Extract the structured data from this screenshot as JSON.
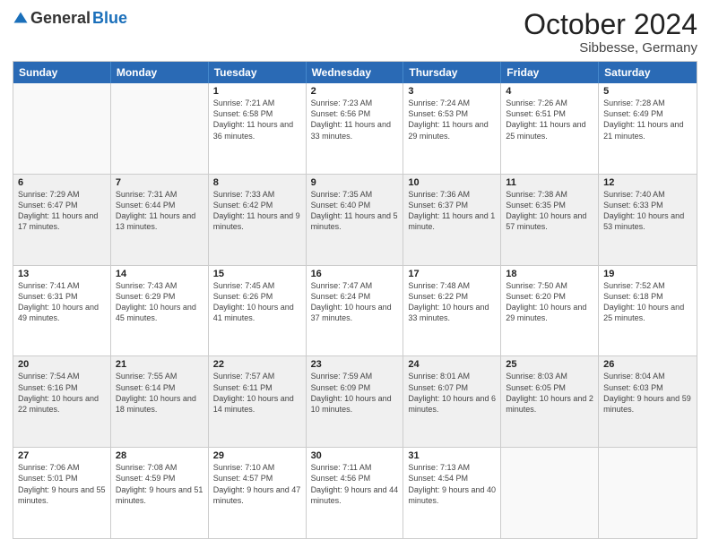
{
  "logo": {
    "general": "General",
    "blue": "Blue"
  },
  "title": "October 2024",
  "location": "Sibbesse, Germany",
  "days": [
    "Sunday",
    "Monday",
    "Tuesday",
    "Wednesday",
    "Thursday",
    "Friday",
    "Saturday"
  ],
  "weeks": [
    [
      {
        "day": "",
        "info": "",
        "empty": true
      },
      {
        "day": "",
        "info": "",
        "empty": true
      },
      {
        "day": "1",
        "info": "Sunrise: 7:21 AM\nSunset: 6:58 PM\nDaylight: 11 hours and 36 minutes."
      },
      {
        "day": "2",
        "info": "Sunrise: 7:23 AM\nSunset: 6:56 PM\nDaylight: 11 hours and 33 minutes."
      },
      {
        "day": "3",
        "info": "Sunrise: 7:24 AM\nSunset: 6:53 PM\nDaylight: 11 hours and 29 minutes."
      },
      {
        "day": "4",
        "info": "Sunrise: 7:26 AM\nSunset: 6:51 PM\nDaylight: 11 hours and 25 minutes."
      },
      {
        "day": "5",
        "info": "Sunrise: 7:28 AM\nSunset: 6:49 PM\nDaylight: 11 hours and 21 minutes."
      }
    ],
    [
      {
        "day": "6",
        "info": "Sunrise: 7:29 AM\nSunset: 6:47 PM\nDaylight: 11 hours and 17 minutes."
      },
      {
        "day": "7",
        "info": "Sunrise: 7:31 AM\nSunset: 6:44 PM\nDaylight: 11 hours and 13 minutes."
      },
      {
        "day": "8",
        "info": "Sunrise: 7:33 AM\nSunset: 6:42 PM\nDaylight: 11 hours and 9 minutes."
      },
      {
        "day": "9",
        "info": "Sunrise: 7:35 AM\nSunset: 6:40 PM\nDaylight: 11 hours and 5 minutes."
      },
      {
        "day": "10",
        "info": "Sunrise: 7:36 AM\nSunset: 6:37 PM\nDaylight: 11 hours and 1 minute."
      },
      {
        "day": "11",
        "info": "Sunrise: 7:38 AM\nSunset: 6:35 PM\nDaylight: 10 hours and 57 minutes."
      },
      {
        "day": "12",
        "info": "Sunrise: 7:40 AM\nSunset: 6:33 PM\nDaylight: 10 hours and 53 minutes."
      }
    ],
    [
      {
        "day": "13",
        "info": "Sunrise: 7:41 AM\nSunset: 6:31 PM\nDaylight: 10 hours and 49 minutes."
      },
      {
        "day": "14",
        "info": "Sunrise: 7:43 AM\nSunset: 6:29 PM\nDaylight: 10 hours and 45 minutes."
      },
      {
        "day": "15",
        "info": "Sunrise: 7:45 AM\nSunset: 6:26 PM\nDaylight: 10 hours and 41 minutes."
      },
      {
        "day": "16",
        "info": "Sunrise: 7:47 AM\nSunset: 6:24 PM\nDaylight: 10 hours and 37 minutes."
      },
      {
        "day": "17",
        "info": "Sunrise: 7:48 AM\nSunset: 6:22 PM\nDaylight: 10 hours and 33 minutes."
      },
      {
        "day": "18",
        "info": "Sunrise: 7:50 AM\nSunset: 6:20 PM\nDaylight: 10 hours and 29 minutes."
      },
      {
        "day": "19",
        "info": "Sunrise: 7:52 AM\nSunset: 6:18 PM\nDaylight: 10 hours and 25 minutes."
      }
    ],
    [
      {
        "day": "20",
        "info": "Sunrise: 7:54 AM\nSunset: 6:16 PM\nDaylight: 10 hours and 22 minutes."
      },
      {
        "day": "21",
        "info": "Sunrise: 7:55 AM\nSunset: 6:14 PM\nDaylight: 10 hours and 18 minutes."
      },
      {
        "day": "22",
        "info": "Sunrise: 7:57 AM\nSunset: 6:11 PM\nDaylight: 10 hours and 14 minutes."
      },
      {
        "day": "23",
        "info": "Sunrise: 7:59 AM\nSunset: 6:09 PM\nDaylight: 10 hours and 10 minutes."
      },
      {
        "day": "24",
        "info": "Sunrise: 8:01 AM\nSunset: 6:07 PM\nDaylight: 10 hours and 6 minutes."
      },
      {
        "day": "25",
        "info": "Sunrise: 8:03 AM\nSunset: 6:05 PM\nDaylight: 10 hours and 2 minutes."
      },
      {
        "day": "26",
        "info": "Sunrise: 8:04 AM\nSunset: 6:03 PM\nDaylight: 9 hours and 59 minutes."
      }
    ],
    [
      {
        "day": "27",
        "info": "Sunrise: 7:06 AM\nSunset: 5:01 PM\nDaylight: 9 hours and 55 minutes."
      },
      {
        "day": "28",
        "info": "Sunrise: 7:08 AM\nSunset: 4:59 PM\nDaylight: 9 hours and 51 minutes."
      },
      {
        "day": "29",
        "info": "Sunrise: 7:10 AM\nSunset: 4:57 PM\nDaylight: 9 hours and 47 minutes."
      },
      {
        "day": "30",
        "info": "Sunrise: 7:11 AM\nSunset: 4:56 PM\nDaylight: 9 hours and 44 minutes."
      },
      {
        "day": "31",
        "info": "Sunrise: 7:13 AM\nSunset: 4:54 PM\nDaylight: 9 hours and 40 minutes."
      },
      {
        "day": "",
        "info": "",
        "empty": true
      },
      {
        "day": "",
        "info": "",
        "empty": true
      }
    ]
  ]
}
